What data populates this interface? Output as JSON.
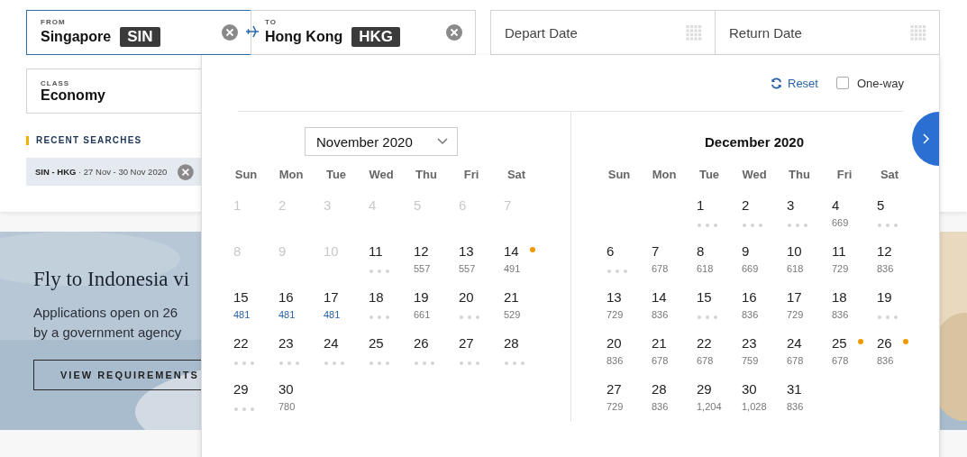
{
  "search": {
    "from": {
      "label": "FROM",
      "city": "Singapore",
      "code": "SIN",
      "focused": true
    },
    "to": {
      "label": "TO",
      "city": "Hong Kong",
      "code": "HKG",
      "focused": false
    },
    "depart": {
      "placeholder": "Depart Date"
    },
    "return": {
      "placeholder": "Return Date"
    },
    "class": {
      "label": "CLASS",
      "value": "Economy"
    }
  },
  "recent": {
    "heading": "RECENT SEARCHES",
    "items": [
      {
        "text": "**SIN - HKG** · 27 Nov - 30 Nov 2020"
      }
    ]
  },
  "banner": {
    "kind": "picture",
    "title": "Fly to Indonesia vi",
    "lines": [
      "Applications open on 26",
      "by a government agency"
    ],
    "button": "VIEW REQUIREMENTS"
  },
  "calendar": {
    "reset": "Reset",
    "one_way": {
      "label": "One-way",
      "checked": false
    },
    "months": [
      {
        "title": "November 2020",
        "kind": "dropdown",
        "weekdays": [
          "Sun",
          "Mon",
          "Tue",
          "Wed",
          "Thu",
          "Fri",
          "Sat"
        ],
        "days": [
          {
            "day": "1",
            "kind": "disabled"
          },
          {
            "day": "2",
            "kind": "disabled"
          },
          {
            "day": "3",
            "kind": "disabled"
          },
          {
            "day": "4",
            "kind": "disabled"
          },
          {
            "day": "5",
            "kind": "disabled"
          },
          {
            "day": "6",
            "kind": "disabled"
          },
          {
            "day": "7",
            "kind": "disabled"
          },
          {
            "day": "8",
            "kind": "disabled"
          },
          {
            "day": "9",
            "kind": "disabled"
          },
          {
            "day": "10",
            "kind": "disabled"
          },
          {
            "day": "11",
            "kind": "pending",
            "marked": false
          },
          {
            "day": "12",
            "kind": "fare",
            "fare": "557",
            "marked": false
          },
          {
            "day": "13",
            "kind": "fare",
            "fare": "557",
            "marked": false
          },
          {
            "day": "14",
            "kind": "fare",
            "fare": "491",
            "marked": true
          },
          {
            "day": "15",
            "kind": "lowest",
            "fare": "481",
            "marked": false
          },
          {
            "day": "16",
            "kind": "lowest",
            "fare": "481",
            "marked": false
          },
          {
            "day": "17",
            "kind": "lowest",
            "fare": "481",
            "marked": false
          },
          {
            "day": "18",
            "kind": "pending",
            "marked": false
          },
          {
            "day": "19",
            "kind": "fare",
            "fare": "661",
            "marked": false
          },
          {
            "day": "20",
            "kind": "pending",
            "marked": false
          },
          {
            "day": "21",
            "kind": "fare",
            "fare": "529",
            "marked": false
          },
          {
            "day": "22",
            "kind": "pending",
            "marked": false
          },
          {
            "day": "23",
            "kind": "pending",
            "marked": false
          },
          {
            "day": "24",
            "kind": "pending",
            "marked": false
          },
          {
            "day": "25",
            "kind": "pending",
            "marked": false
          },
          {
            "day": "26",
            "kind": "pending",
            "marked": false
          },
          {
            "day": "27",
            "kind": "pending",
            "marked": false
          },
          {
            "day": "28",
            "kind": "pending",
            "marked": false
          },
          {
            "day": "29",
            "kind": "pending",
            "marked": false
          },
          {
            "day": "30",
            "kind": "fare",
            "fare": "780",
            "marked": false
          }
        ]
      },
      {
        "title": "December 2020",
        "kind": "plain",
        "weekdays": [
          "Sun",
          "Mon",
          "Tue",
          "Wed",
          "Thu",
          "Fri",
          "Sat"
        ],
        "days": [
          {
            "kind": "blank"
          },
          {
            "kind": "blank"
          },
          {
            "day": "1",
            "kind": "pending",
            "marked": false
          },
          {
            "day": "2",
            "kind": "pending",
            "marked": false
          },
          {
            "day": "3",
            "kind": "pending",
            "marked": false
          },
          {
            "day": "4",
            "kind": "fare",
            "fare": "669",
            "marked": false
          },
          {
            "day": "5",
            "kind": "pending",
            "marked": false
          },
          {
            "day": "6",
            "kind": "pending",
            "marked": false
          },
          {
            "day": "7",
            "kind": "fare",
            "fare": "678",
            "marked": false
          },
          {
            "day": "8",
            "kind": "fare",
            "fare": "618",
            "marked": false
          },
          {
            "day": "9",
            "kind": "fare",
            "fare": "669",
            "marked": false
          },
          {
            "day": "10",
            "kind": "fare",
            "fare": "618",
            "marked": false
          },
          {
            "day": "11",
            "kind": "fare",
            "fare": "729",
            "marked": false
          },
          {
            "day": "12",
            "kind": "fare",
            "fare": "836",
            "marked": false
          },
          {
            "day": "13",
            "kind": "fare",
            "fare": "729",
            "marked": false
          },
          {
            "day": "14",
            "kind": "fare",
            "fare": "836",
            "marked": false
          },
          {
            "day": "15",
            "kind": "pending",
            "marked": false
          },
          {
            "day": "16",
            "kind": "fare",
            "fare": "836",
            "marked": false
          },
          {
            "day": "17",
            "kind": "fare",
            "fare": "729",
            "marked": false
          },
          {
            "day": "18",
            "kind": "fare",
            "fare": "836",
            "marked": false
          },
          {
            "day": "19",
            "kind": "pending",
            "marked": false
          },
          {
            "day": "20",
            "kind": "fare",
            "fare": "836",
            "marked": false
          },
          {
            "day": "21",
            "kind": "fare",
            "fare": "678",
            "marked": false
          },
          {
            "day": "22",
            "kind": "fare",
            "fare": "678",
            "marked": false
          },
          {
            "day": "23",
            "kind": "fare",
            "fare": "759",
            "marked": false
          },
          {
            "day": "24",
            "kind": "fare",
            "fare": "678",
            "marked": false
          },
          {
            "day": "25",
            "kind": "fare",
            "fare": "678",
            "marked": true
          },
          {
            "day": "26",
            "kind": "fare",
            "fare": "836",
            "marked": true
          },
          {
            "day": "27",
            "kind": "fare",
            "fare": "729",
            "marked": false
          },
          {
            "day": "28",
            "kind": "fare",
            "fare": "836",
            "marked": false
          },
          {
            "day": "29",
            "kind": "fare",
            "fare": "1,204",
            "marked": false
          },
          {
            "day": "30",
            "kind": "fare",
            "fare": "1,028",
            "marked": false
          },
          {
            "day": "31",
            "kind": "fare",
            "fare": "836",
            "marked": false
          }
        ]
      }
    ]
  }
}
